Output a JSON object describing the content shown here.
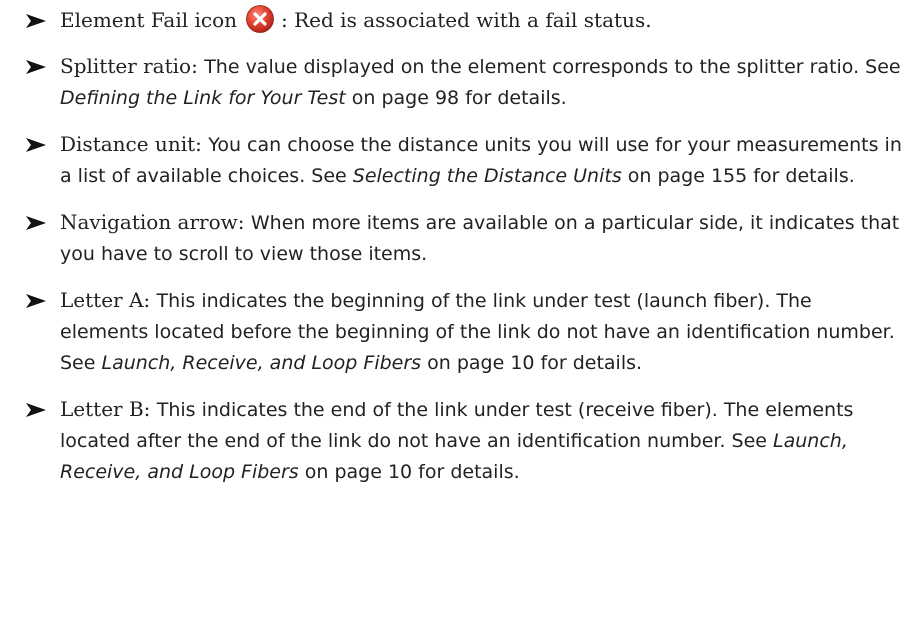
{
  "items": [
    {
      "lead": "Element Fail icon",
      "icon": "fail-icon",
      "rest": ": Red is associated with a fail status."
    },
    {
      "lead": "Splitter ratio:",
      "text": "The value displayed on the element corresponds to the splitter ratio. See ",
      "ref": "Defining the Link for Your Test",
      "suffix": " on page 98 for details."
    },
    {
      "lead": "Distance unit:",
      "text": "You can choose the distance units you will use for your measurements in a list of available choices. See ",
      "ref": "Selecting the Distance Units",
      "suffix": " on page 155 for details."
    },
    {
      "lead": "Navigation arrow:",
      "text": "When more items are available on a particular side, it indicates that you have to scroll to view those items."
    },
    {
      "lead": "Letter A:",
      "text": "This indicates the beginning of the link under test (launch fiber). The elements located before the beginning of the link do not have an identification number. See ",
      "ref": "Launch, Receive, and Loop Fibers",
      "suffix": " on page 10 for details."
    },
    {
      "lead": "Letter B:",
      "text": "This indicates the end of the link under test (receive fiber). The elements located after the end of the link do not have an identification number. See ",
      "ref": "Launch, Receive, and Loop Fibers",
      "suffix": " on page 10 for details."
    }
  ],
  "colors": {
    "text": "#222222",
    "bullet": "#111111",
    "fail_icon": "#d9342b"
  }
}
